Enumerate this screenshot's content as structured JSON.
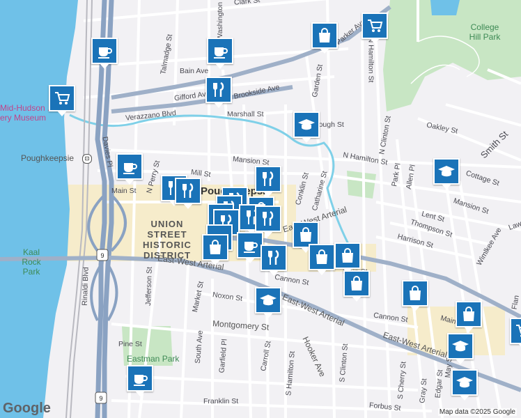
{
  "map": {
    "city_label": "Poughkeepsie",
    "station_label": "Poughkeepsie",
    "district_label": "UNION STREET HISTORIC DISTRICT",
    "parks": [
      "College Hill Park",
      "Kaal Rock Park",
      "Eastman Park"
    ],
    "museum_label": "Mid-Hudson ... ery Museum",
    "streets": {
      "clark": "Clark St",
      "parker": "Parker Ave",
      "talmadge": "Talmadge St",
      "bain": "Bain Ave",
      "gifford": "Gifford Ave",
      "brookside": "Brookside Ave",
      "verazzano": "Verazzano Blvd",
      "marshall": "Marshall St",
      "garden": "Garden St",
      "n_hamilton": "N Hamilton St",
      "n_clinton": "N Clinton St",
      "oakley": "Oakley St",
      "smith": "Smith St",
      "cottage": "Cottage St",
      "mansion": "Mansion St",
      "mansion2": "Mansion St",
      "lent": "Lent St",
      "thompson": "Thompson St",
      "harrison": "Harrison St",
      "wimlkee": "Wimlkee Ave",
      "park_pl": "Park Pl",
      "allen_pl": "Allen Pl",
      "n_hamilton2": "N Hamilton St",
      "catharine": "Catharine St",
      "conklin": "Conklin St",
      "mill": "Mill St",
      "main": "Main St",
      "main2": "Main St",
      "main3": "Main St",
      "davies": "Davies Pl",
      "n_perry": "N Perry St",
      "jefferson": "Jefferson St",
      "rinaldi": "Rinaldi Blvd",
      "market": "Market St",
      "noxon": "Noxon St",
      "cannon": "Cannon St",
      "cannon2": "Cannon St",
      "arterial1": "East-West Arterial",
      "arterial2": "East-West Arterial",
      "arterial3": "East-West Arterial",
      "arterial4": "East-West Arterial",
      "montgomery": "Montgomery St",
      "pine": "Pine St",
      "south": "South Ave",
      "garfield": "Garfield Pl",
      "carroll": "Carroll St",
      "s_hamilton": "S Hamilton St",
      "hooker": "Hooker Ave",
      "s_clinton": "S Clinton St",
      "s_cherry": "S Cherry St",
      "gray": "Gray St",
      "edgar": "Edgar St",
      "may": "May St",
      "franklin": "Franklin St",
      "forbus": "Forbus St",
      "washington": "Washington St",
      "lawn": "Law",
      "flan": "Flan",
      "hough": "Hough St"
    },
    "route_shield": "9",
    "route_shield2": "9",
    "attribution": "Map data ©2025 Google",
    "logo": "Google"
  },
  "pois": [
    {
      "name": "coffee-cup-icon",
      "kind": "coffee"
    },
    {
      "name": "coffee-cup-icon",
      "kind": "coffee"
    },
    {
      "name": "shopping-cart-icon",
      "kind": "cart"
    },
    {
      "name": "shopping-bag-icon",
      "kind": "bag"
    },
    {
      "name": "shopping-cart-icon",
      "kind": "cart"
    },
    {
      "name": "restaurant-icon",
      "kind": "food"
    },
    {
      "name": "graduation-cap-icon",
      "kind": "school"
    },
    {
      "name": "coffee-cup-icon",
      "kind": "coffee"
    },
    {
      "name": "restaurant-icon",
      "kind": "food"
    },
    {
      "name": "restaurant-icon",
      "kind": "food"
    },
    {
      "name": "graduation-cap-icon",
      "kind": "school"
    }
  ],
  "colors": {
    "marker": "#1a73b8",
    "water": "#6fc1e8",
    "park": "#c8e6c4",
    "highway": "#8aa2c2",
    "arterial": "#9fb0c8",
    "downtown": "#f6eccb",
    "stream": "#7fd0e8"
  }
}
